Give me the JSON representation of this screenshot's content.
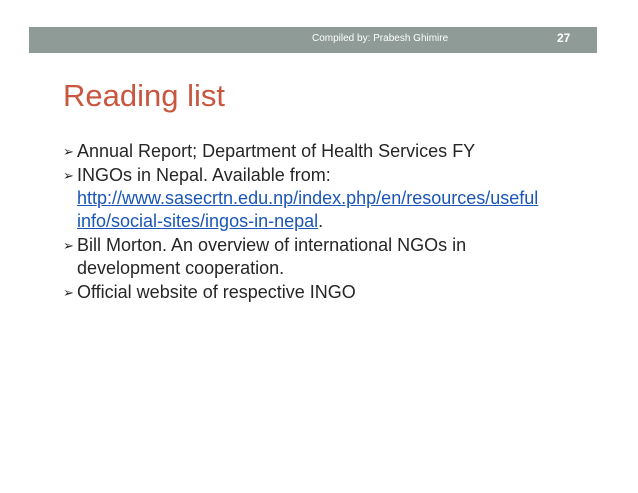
{
  "header": {
    "credit": "Compiled by: Prabesh Ghimire",
    "slide_number": "27"
  },
  "slide": {
    "title": "Reading list",
    "bullet_glyph": "➢",
    "items": [
      {
        "text": "Annual Report; Department of Health Services FY"
      },
      {
        "text": "INGOs in Nepal. Available from:",
        "link_line1": "http://www.sasecrtn.edu.np/index.php/en/resources/useful",
        "link_line2": "info/social-sites/ingos-in-nepal",
        "trailing": "."
      },
      {
        "text": "Bill Morton. An overview of international NGOs in",
        "text_line2": "development cooperation."
      },
      {
        "text": "Official website of respective INGO"
      }
    ]
  },
  "colors": {
    "header_band": "#8f9b96",
    "title": "#c9573f",
    "link": "#1a56b8",
    "body_text": "#262626"
  }
}
